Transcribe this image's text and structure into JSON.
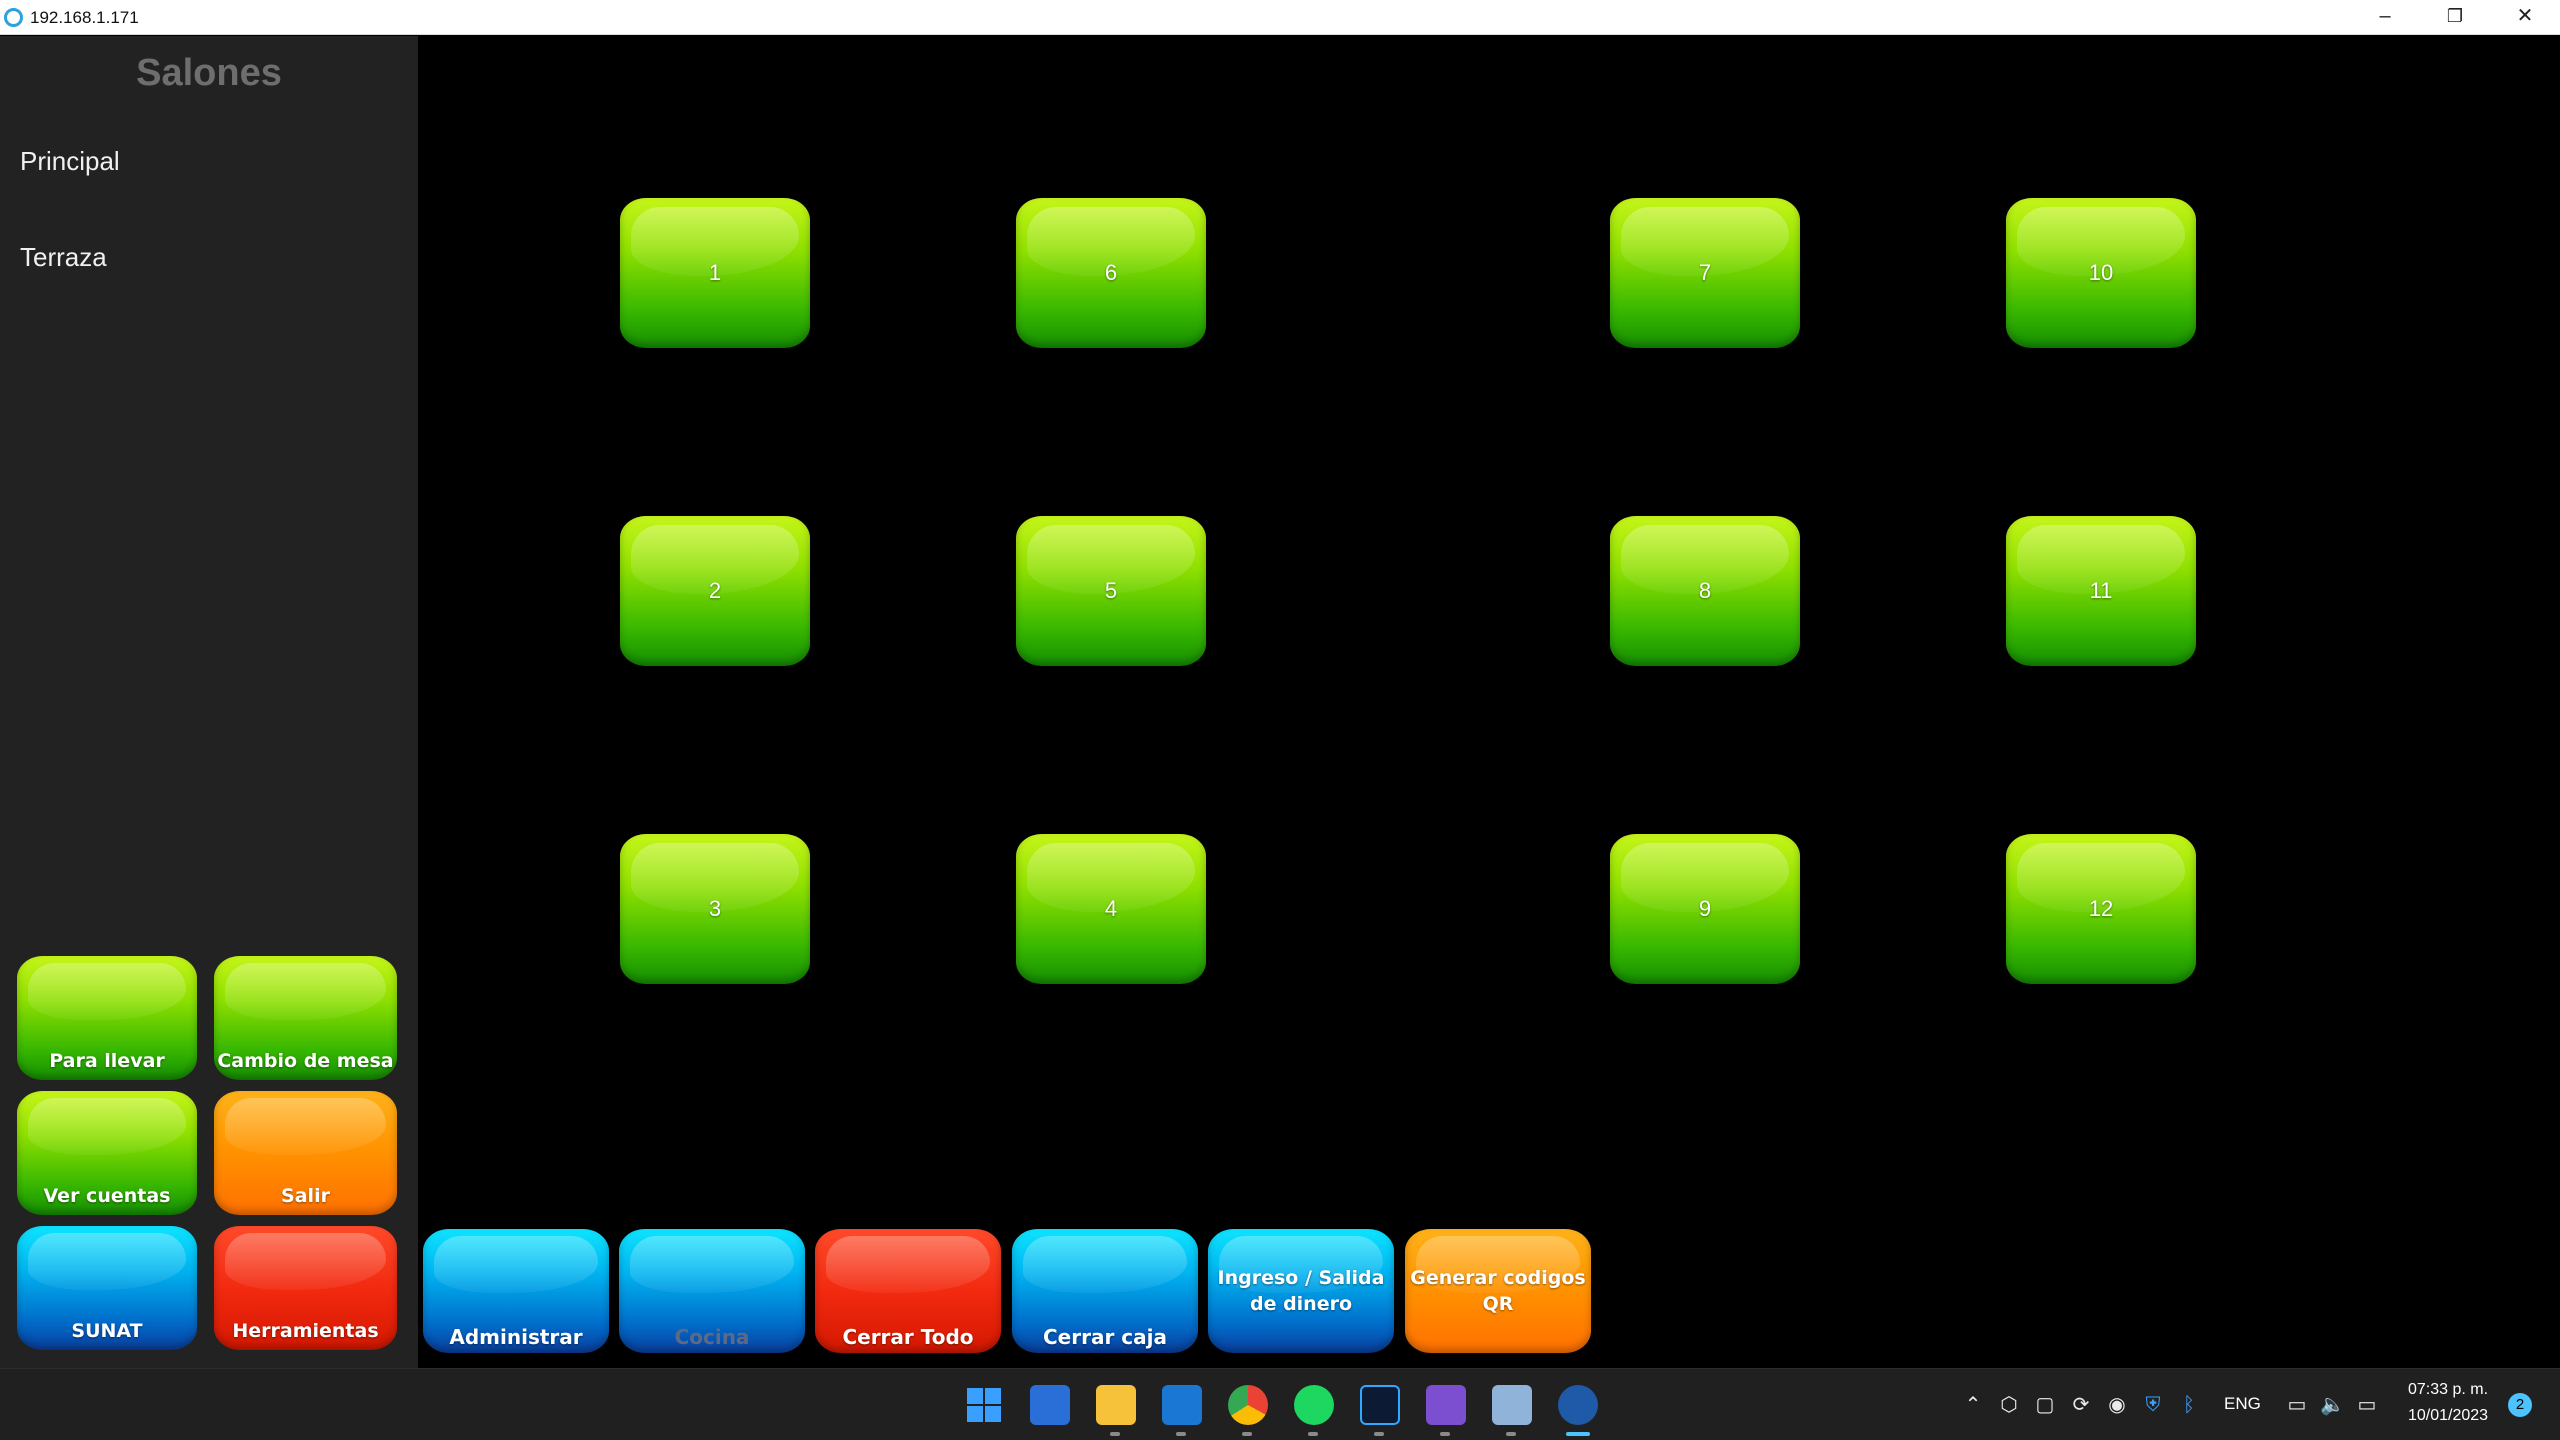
{
  "window": {
    "title": "192.168.1.171",
    "minimize": "–",
    "restore": "❐",
    "close": "✕"
  },
  "sidebar": {
    "heading": "Salones",
    "salons": [
      "Principal",
      "Terraza"
    ],
    "actions": {
      "para_llevar": "Para llevar",
      "cambio_mesa": "Cambio de mesa",
      "ver_cuentas": "Ver cuentas",
      "salir": "Salir",
      "sunat": "SUNAT",
      "herramientas": "Herramientas"
    }
  },
  "tables": [
    "1",
    "6",
    "7",
    "10",
    "2",
    "5",
    "8",
    "11",
    "3",
    "4",
    "9",
    "12"
  ],
  "bottom_actions": {
    "administrar": "Administrar",
    "cocina": "Cocina",
    "cerrar_todo": "Cerrar Todo",
    "cerrar_caja": "Cerrar caja",
    "ingreso_line1": "Ingreso / Salida",
    "ingreso_line2": "de dinero",
    "qr_line1": "Generar codigos",
    "qr_line2": "QR"
  },
  "taskbar": {
    "lang": "ENG",
    "time": "07:33 p. m.",
    "date": "10/01/2023",
    "notifications": "2"
  },
  "colors": {
    "green_tile": "#7fd600",
    "orange_tile": "#ff8c00",
    "red_tile": "#f02a10",
    "blue_tile": "#00a8ee",
    "sidebar_bg": "#222222"
  }
}
